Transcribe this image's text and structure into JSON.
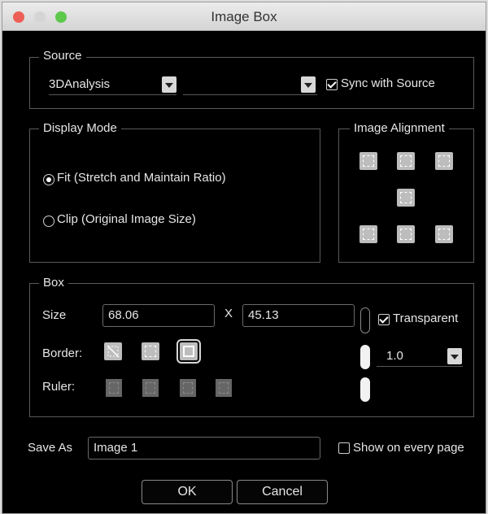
{
  "window": {
    "title": "Image Box",
    "traffic_lights": {
      "close": "#ed5f56",
      "minimize": "#d5d5d5",
      "zoom": "#5ec84d"
    }
  },
  "source": {
    "title": "Source",
    "selected": "3DAnalysis",
    "second_selected": "",
    "sync_label": "Sync with Source",
    "sync_checked": true
  },
  "display_mode": {
    "title": "Display Mode",
    "options": [
      {
        "label": "Fit (Stretch and Maintain Ratio)",
        "checked": true
      },
      {
        "label": "Clip (Original Image Size)",
        "checked": false
      }
    ]
  },
  "image_alignment": {
    "title": "Image Alignment"
  },
  "box": {
    "title": "Box",
    "size_label": "Size",
    "width": "68.06",
    "x_label": "X",
    "height": "45.13",
    "transparent_label": "Transparent",
    "transparent_checked": true,
    "border_label": "Border:",
    "border_selected": "solid",
    "ruler_label": "Ruler:",
    "line_width": "1.0"
  },
  "save_as": {
    "label": "Save As",
    "value": "Image 1",
    "show_every_page_label": "Show on every page",
    "show_every_page_checked": false
  },
  "buttons": {
    "ok": "OK",
    "cancel": "Cancel"
  }
}
